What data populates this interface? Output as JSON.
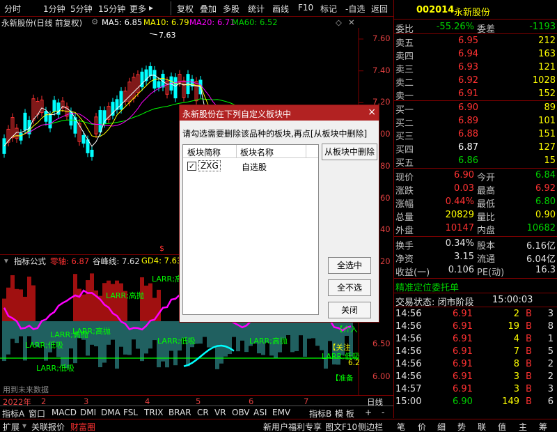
{
  "toolbar": {
    "items": [
      "分时",
      "1分钟",
      "5分钟",
      "15分钟",
      "更多",
      "复权",
      "叠加",
      "多股",
      "统计",
      "画线",
      "F10",
      "标记",
      "-自选",
      "返回"
    ],
    "more_arrow": "▸"
  },
  "chart_header": {
    "stock_title": "永新股份(日线 前复权)",
    "ma5": "MA5: 6.85",
    "ma10": "MA10: 6.79",
    "ma20": "MA20: 6.71",
    "ma60": "MA60: 6.52",
    "peak_label": "7.63"
  },
  "price_axis": [
    "7.60",
    "7.40",
    "7.20",
    "7.00",
    "6.80",
    "6.60",
    "6.40",
    "6.20"
  ],
  "indicator_header": {
    "name": "指标公式",
    "zero_axis": "零轴: 6.87",
    "valley_line": "谷峰线: 7.62",
    "gd4": "GD4: 7.63"
  },
  "indicator_axis": [
    "6.50",
    "6.00"
  ],
  "indicator_labels": {
    "high_1": "LARR;高抛",
    "high_2": "LARR;高抛",
    "high_3": "LARR;高抛",
    "high_4": "LARR;高抛",
    "high_5": "LARR;高抛",
    "low_1": "LARR;低吸",
    "low_2": "LARR;低吸",
    "low_3": "LARR;低吸",
    "low_4": "LARR;低吸",
    "note": "用到未来数据",
    "side_a": "【关注",
    "side_b": "【介入",
    "side_c": "【准备",
    "side_d": "6.2"
  },
  "date_axis": {
    "year": "2022年",
    "months": [
      "2",
      "3",
      "4",
      "5",
      "6",
      "7"
    ],
    "right": "日线"
  },
  "indicator_tabs": [
    "指标A",
    "窗口",
    "MACD",
    "DMI",
    "DMA",
    "FSL",
    "TRIX",
    "BRAR",
    "CR",
    "VR",
    "OBV",
    "ASI",
    "EMV"
  ],
  "indicator_tabs_right": [
    "指标B",
    "模 板",
    "+",
    "-"
  ],
  "bottom_bar": {
    "left": [
      "扩展",
      "关联报价",
      "财富圈"
    ],
    "promo": "新用户福利专享",
    "tools": [
      "图文F10",
      "侧边栏"
    ],
    "right": [
      "笔",
      "价",
      "细",
      "势",
      "联",
      "值",
      "主",
      "筹"
    ]
  },
  "quote": {
    "code": "002014",
    "name": "永新股份",
    "weibi_label": "委比",
    "weibi_value": "-55.26%",
    "weicha_label": "委差",
    "weicha_value": "-1193",
    "asks": [
      {
        "label": "卖五",
        "price": "6.95",
        "vol": "212"
      },
      {
        "label": "卖四",
        "price": "6.94",
        "vol": "163"
      },
      {
        "label": "卖三",
        "price": "6.93",
        "vol": "121"
      },
      {
        "label": "卖二",
        "price": "6.92",
        "vol": "1028"
      },
      {
        "label": "卖一",
        "price": "6.91",
        "vol": "152"
      }
    ],
    "bids": [
      {
        "label": "买一",
        "price": "6.90",
        "vol": "89"
      },
      {
        "label": "买二",
        "price": "6.89",
        "vol": "101"
      },
      {
        "label": "买三",
        "price": "6.88",
        "vol": "151"
      },
      {
        "label": "买四",
        "price": "6.87",
        "vol": "127"
      },
      {
        "label": "买五",
        "price": "6.86",
        "vol": "15"
      }
    ],
    "stats": [
      {
        "l1": "现价",
        "v1": "6.90",
        "l2": "今开",
        "v2": "6.84"
      },
      {
        "l1": "涨跌",
        "v1": "0.03",
        "l2": "最高",
        "v2": "6.92"
      },
      {
        "l1": "涨幅",
        "v1": "0.44%",
        "l2": "最低",
        "v2": "6.80"
      },
      {
        "l1": "总量",
        "v1": "20829",
        "l2": "量比",
        "v2": "0.90"
      },
      {
        "l1": "外盘",
        "v1": "10147",
        "l2": "内盘",
        "v2": "10682"
      }
    ],
    "fund": [
      {
        "l1": "换手",
        "v1": "0.34%",
        "l2": "股本",
        "v2": "6.16亿"
      },
      {
        "l1": "净资",
        "v1": "3.15",
        "l2": "流通",
        "v2": "6.04亿"
      },
      {
        "l1": "收益(一)",
        "v1": "0.106",
        "l2": "PE(动)",
        "v2": "16.3"
      }
    ],
    "precise": "精准定位委托单",
    "trade_state_label": "交易状态: 闭市阶段",
    "trade_state_time": "15:00:03",
    "ticks": [
      {
        "time": "14:56",
        "price": "6.91",
        "vol": "2",
        "side": "B",
        "n": "3"
      },
      {
        "time": "14:56",
        "price": "6.91",
        "vol": "19",
        "side": "B",
        "n": "8"
      },
      {
        "time": "14:56",
        "price": "6.91",
        "vol": "4",
        "side": "B",
        "n": "1"
      },
      {
        "time": "14:56",
        "price": "6.91",
        "vol": "7",
        "side": "B",
        "n": "5"
      },
      {
        "time": "14:56",
        "price": "6.91",
        "vol": "8",
        "side": "B",
        "n": "2"
      },
      {
        "time": "14:56",
        "price": "6.91",
        "vol": "3",
        "side": "B",
        "n": "2"
      },
      {
        "time": "14:57",
        "price": "6.91",
        "vol": "3",
        "side": "B",
        "n": "3"
      },
      {
        "time": "15:00",
        "price": "6.90",
        "vol": "149",
        "side": "B",
        "n": "6"
      }
    ]
  },
  "dialog": {
    "title": "永新股份在下列自定义板块中",
    "close": "×",
    "instruction": "请勾选需要删除该品种的板块,再点[从板块中删除]",
    "delete_button": "从板块中删除",
    "col_short": "板块简称",
    "col_name": "板块名称",
    "row_short": "ZXG",
    "row_name": "自选股",
    "row_checked": true,
    "select_all": "全选中",
    "select_none": "全不选",
    "close_button": "关闭"
  },
  "colors": {
    "up": "#ff3232",
    "down": "#00d000",
    "accent": "#b22222",
    "ma5": "#ffffff",
    "ma10": "#ffff00",
    "ma20": "#ff00ff",
    "ma60": "#00ff00"
  }
}
